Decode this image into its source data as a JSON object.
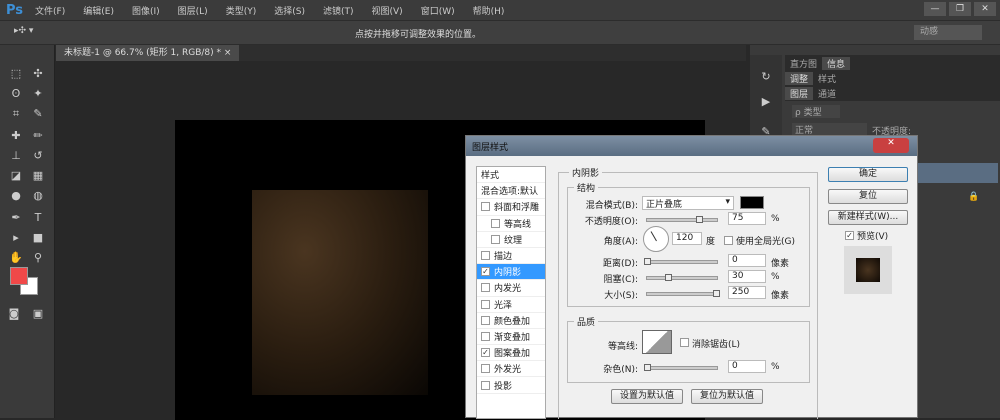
{
  "app": {
    "logo": "Ps",
    "menus": [
      "文件(F)",
      "编辑(E)",
      "图像(I)",
      "图层(L)",
      "类型(Y)",
      "选择(S)",
      "滤镜(T)",
      "视图(V)",
      "窗口(W)",
      "帮助(H)"
    ],
    "window_controls": [
      "—",
      "❐",
      "✕"
    ]
  },
  "options": {
    "hint": "点按并拖移可调整效果的位置。",
    "workspace": "动感"
  },
  "document": {
    "tab": "未标题-1 @ 66.7% (矩形 1, RGB/8) *",
    "close": "×"
  },
  "panels": {
    "row1": [
      "直方图",
      "信息"
    ],
    "row2": [
      "调整",
      "样式"
    ],
    "row3": [
      "图层",
      "通道"
    ],
    "filter": "ρ 类型",
    "blend": "正常",
    "opacity_label": "不透明度:"
  },
  "colors": {
    "foreground": "#f04848",
    "background": "#ffffff"
  },
  "dialog": {
    "title": "图层样式",
    "close": "✕",
    "styles_header": "样式",
    "blend_options": "混合选项:默认",
    "styles": [
      {
        "label": "斜面和浮雕",
        "checked": false,
        "indent": false
      },
      {
        "label": "等高线",
        "checked": false,
        "indent": true
      },
      {
        "label": "纹理",
        "checked": false,
        "indent": true
      },
      {
        "label": "描边",
        "checked": false,
        "indent": false
      },
      {
        "label": "内阴影",
        "checked": true,
        "indent": false,
        "selected": true
      },
      {
        "label": "内发光",
        "checked": false
      },
      {
        "label": "光泽",
        "checked": false
      },
      {
        "label": "颜色叠加",
        "checked": false
      },
      {
        "label": "渐变叠加",
        "checked": false
      },
      {
        "label": "图案叠加",
        "checked": true
      },
      {
        "label": "外发光",
        "checked": false
      },
      {
        "label": "投影",
        "checked": false
      }
    ],
    "section": "内阴影",
    "structure": "结构",
    "blend_mode_label": "混合模式(B):",
    "blend_mode": "正片叠底",
    "shadow_color": "#000000",
    "opacity_label": "不透明度(O):",
    "opacity": "75",
    "opacity_unit": "%",
    "angle_label": "角度(A):",
    "angle": "120",
    "angle_unit": "度",
    "global_light": "使用全局光(G)",
    "distance_label": "距离(D):",
    "distance": "0",
    "distance_unit": "像素",
    "choke_label": "阻塞(C):",
    "choke": "30",
    "choke_unit": "%",
    "size_label": "大小(S):",
    "size": "250",
    "size_unit": "像素",
    "quality": "品质",
    "contour_label": "等高线:",
    "antialias": "消除锯齿(L)",
    "noise_label": "杂色(N):",
    "noise": "0",
    "noise_unit": "%",
    "make_default": "设置为默认值",
    "reset_default": "复位为默认值",
    "ok": "确定",
    "reset": "复位",
    "new_style": "新建样式(W)...",
    "preview": "预览(V)"
  }
}
